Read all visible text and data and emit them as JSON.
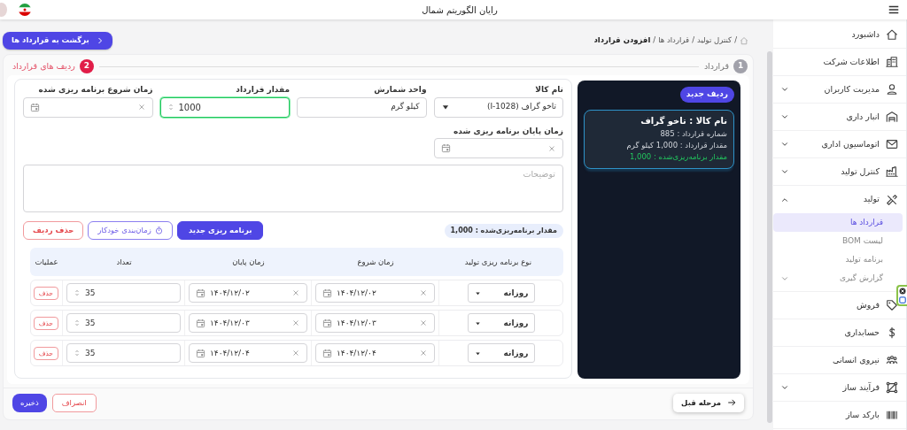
{
  "topbar": {
    "title": "رایان الگوریتم شمال"
  },
  "sidebar": {
    "items": [
      {
        "label": "داشبورد"
      },
      {
        "label": "اطلاعات شرکت"
      },
      {
        "label": "مدیریت کاربران",
        "expanded": false
      },
      {
        "label": "انبار داری",
        "expanded": false
      },
      {
        "label": "اتوماسیون اداری",
        "expanded": false
      },
      {
        "label": "کنترل تولید",
        "expanded": false
      },
      {
        "label": "تولید",
        "expanded": true,
        "children": [
          {
            "label": "قرارداد ها",
            "selected": true
          },
          {
            "label": "لیست BOM",
            "selected": false
          },
          {
            "label": "برنامه تولید",
            "selected": false
          },
          {
            "label": "گزارش گیری",
            "selected": false,
            "expanded": false
          }
        ]
      },
      {
        "label": "فروش"
      },
      {
        "label": "حسابداری"
      },
      {
        "label": "نیروی انسانی"
      },
      {
        "label": "فرآیند ساز",
        "expanded": false
      },
      {
        "label": "بارکد ساز"
      }
    ]
  },
  "back_button": "برگشت به قرارداد ها",
  "breadcrumb": {
    "separator": "/",
    "items": [
      "کنترل تولید",
      "قرارداد ها",
      "افزودن قرارداد"
    ]
  },
  "steps": [
    {
      "number": "1",
      "label": "قرارداد",
      "active": false
    },
    {
      "number": "2",
      "label": "ردیف های قرارداد",
      "active": true
    }
  ],
  "contract_panel": {
    "badge": "ردیف جدید",
    "rows": [
      {
        "title": "نام کالا : تاخو گراف",
        "lines": [
          "شماره قرارداد : 885",
          "مقدار قرارداد : 1,000 کیلو گرم"
        ],
        "planned": "مقدار برنامه‌ریزی‌شده : 1,000"
      }
    ]
  },
  "form": {
    "fields": [
      {
        "kind": "select",
        "label": "نام کالا",
        "value": "تاخو گراف (I-1028)"
      },
      {
        "kind": "text",
        "label": "واحد شمارش",
        "value": "کیلو گرم"
      },
      {
        "kind": "number",
        "label": "مقدار قرارداد",
        "value": "1000",
        "focused": true
      },
      {
        "kind": "date",
        "label": "زمان شروع برنامه ریزی شده"
      },
      {
        "kind": "date",
        "label": "زمان پایان برنامه ریزی شده"
      }
    ],
    "notes": {
      "placeholder": "توضیحات"
    }
  },
  "planned_badge": "مقدار برنامه‌ریزی‌شده : 1,000",
  "actions": [
    {
      "kind": "primary",
      "label": "برنامه ریزی جدید"
    },
    {
      "kind": "outline",
      "label": "زمان‌بندی خودکار"
    },
    {
      "kind": "danger",
      "label": "حذف ردیف"
    }
  ],
  "schedule_table": {
    "columns": [
      "نوع برنامه ریزی تولید",
      "زمان شروع",
      "زمان پایان",
      "تعداد",
      "عملیات"
    ],
    "rows": [
      {
        "type": "روزانه",
        "start": "۱۴۰۴/۱۲/۰۲",
        "end": "۱۴۰۴/۱۲/۰۲",
        "count": "35",
        "action": "حذف"
      },
      {
        "type": "روزانه",
        "start": "۱۴۰۴/۱۲/۰۳",
        "end": "۱۴۰۴/۱۲/۰۳",
        "count": "35",
        "action": "حذف"
      },
      {
        "type": "روزانه",
        "start": "۱۴۰۴/۱۲/۰۴",
        "end": "۱۴۰۴/۱۲/۰۴",
        "count": "35",
        "action": "حذف"
      }
    ]
  },
  "footer": {
    "previous": "مرحله قبل",
    "cancel": "انصراف",
    "save": "ذخیره"
  }
}
